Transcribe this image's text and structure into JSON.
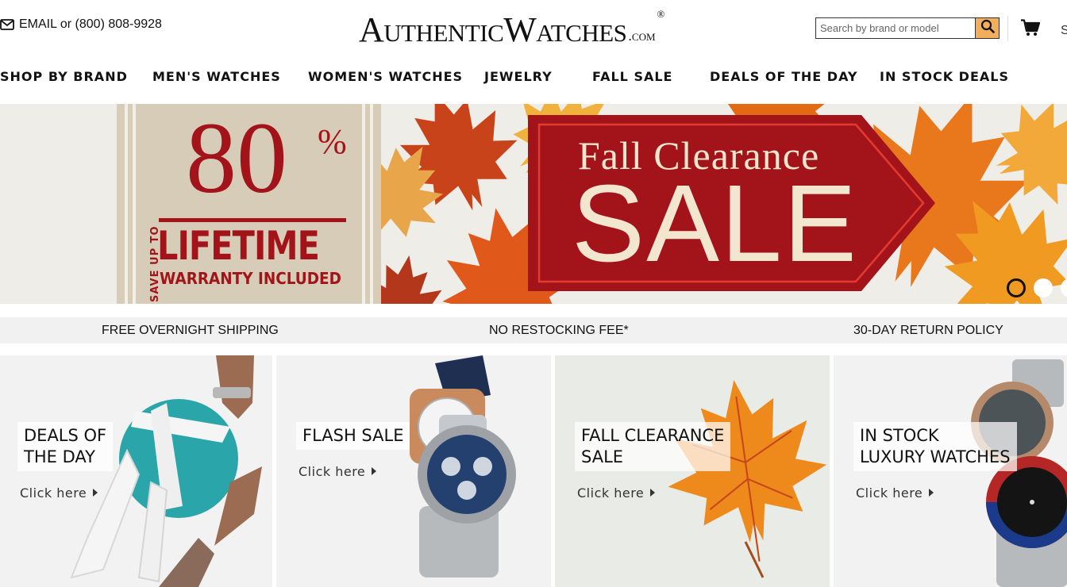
{
  "header": {
    "contact_text": "EMAIL or (800) 808-9928",
    "logo_main": "AuthenticWatches",
    "logo_com": ".com",
    "logo_reg": "®",
    "search_placeholder": "Search by brand or model",
    "cut_letter": "S"
  },
  "nav": {
    "items": [
      {
        "label": "SHOP BY BRAND"
      },
      {
        "label": "MEN'S WATCHES"
      },
      {
        "label": "WOMEN'S WATCHES"
      },
      {
        "label": "JEWELRY"
      },
      {
        "label": "FALL SALE"
      },
      {
        "label": "DEALS OF THE DAY"
      },
      {
        "label": "IN STOCK DEALS"
      }
    ]
  },
  "hero": {
    "save_up_to": "SAVE UP TO",
    "percent_value": "80",
    "percent_sign": "%",
    "lifetime": "LIFETIME",
    "warranty": "WARRANTY INCLUDED",
    "headline": "Fall Clearance",
    "sale": "SALE",
    "carousel_active_index": 0,
    "carousel_count": 3
  },
  "benefits": [
    {
      "text": "FREE OVERNIGHT SHIPPING"
    },
    {
      "text": "NO RESTOCKING FEE*"
    },
    {
      "text": "30-DAY RETURN POLICY"
    }
  ],
  "tiles": [
    {
      "line1": "DEALS OF",
      "line2": "THE DAY",
      "cta": "Click here"
    },
    {
      "line1": "FLASH SALE",
      "line2": "",
      "cta": "Click here"
    },
    {
      "line1": "FALL CLEARANCE",
      "line2": "SALE",
      "cta": "Click here"
    },
    {
      "line1": "IN STOCK",
      "line2": "LUXURY WATCHES",
      "cta": "Click here"
    }
  ],
  "colors": {
    "brand_red": "#a3141a",
    "search_button": "#f2ae5b",
    "promo_beige": "#d7ccb8",
    "tile_bg": "#f2f2f2"
  },
  "icons": {
    "contact": "envelope-icon",
    "search": "magnifier-icon",
    "cart": "shopping-cart-icon"
  }
}
